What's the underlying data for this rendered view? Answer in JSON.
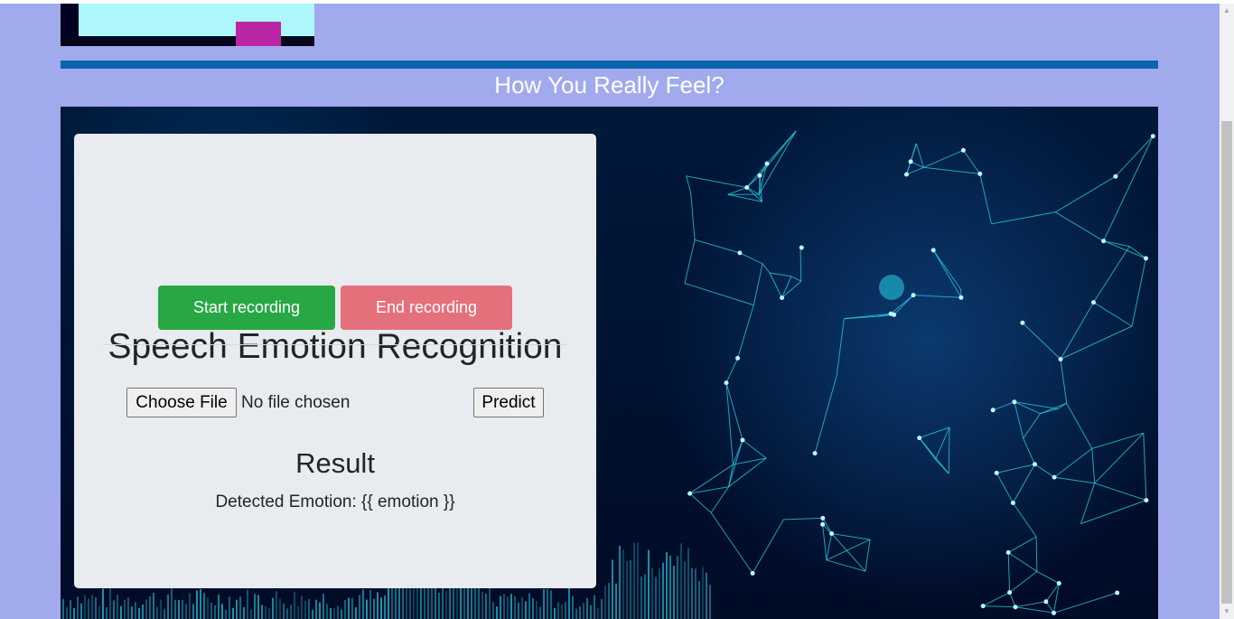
{
  "header": {
    "headline": "How You Really Feel?"
  },
  "card": {
    "title": "Speech Emotion Recognition",
    "start_label": "Start recording",
    "end_label": "End recording",
    "file_button_label": "Choose File",
    "file_status": "No file chosen",
    "predict_label": "Predict",
    "result_title": "Result",
    "result_text": "Detected Emotion: {{ emotion }}"
  },
  "colors": {
    "page_background": "#a1aaec",
    "header_bar": "#0a63ad",
    "start_button": "#28a745",
    "end_button": "#e4707c",
    "card_background": "#e8ebef",
    "hero_wireframe": "#27d1e8"
  },
  "icons": {
    "scroll_up": "scroll-up-arrow",
    "scroll_down": "scroll-down-arrow"
  }
}
